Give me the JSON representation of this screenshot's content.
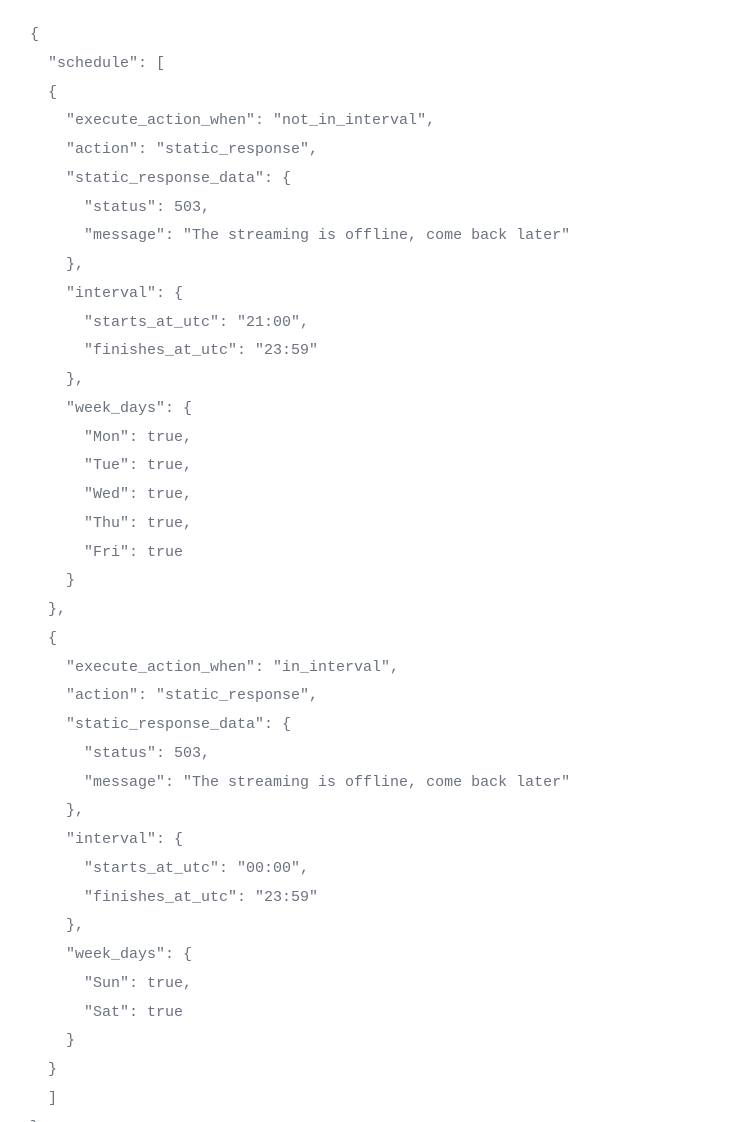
{
  "code": {
    "lines": [
      "{",
      "  \"schedule\": [",
      "  {",
      "    \"execute_action_when\": \"not_in_interval\",",
      "    \"action\": \"static_response\",",
      "    \"static_response_data\": {",
      "      \"status\": 503,",
      "      \"message\": \"The streaming is offline, come back later\"",
      "    },",
      "    \"interval\": {",
      "      \"starts_at_utc\": \"21:00\",",
      "      \"finishes_at_utc\": \"23:59\"",
      "    },",
      "    \"week_days\": {",
      "      \"Mon\": true,",
      "      \"Tue\": true,",
      "      \"Wed\": true,",
      "      \"Thu\": true,",
      "      \"Fri\": true",
      "    }",
      "  },",
      "  {",
      "    \"execute_action_when\": \"in_interval\",",
      "    \"action\": \"static_response\",",
      "    \"static_response_data\": {",
      "      \"status\": 503,",
      "      \"message\": \"The streaming is offline, come back later\"",
      "    },",
      "    \"interval\": {",
      "      \"starts_at_utc\": \"00:00\",",
      "      \"finishes_at_utc\": \"23:59\"",
      "    },",
      "    \"week_days\": {",
      "      \"Sun\": true,",
      "      \"Sat\": true",
      "    }",
      "  }",
      "  ]",
      "}"
    ]
  }
}
